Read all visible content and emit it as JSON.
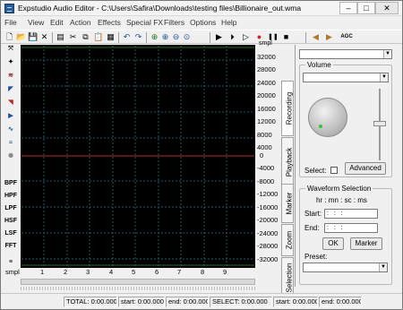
{
  "window": {
    "title": "Expstudio Audio Editor - C:\\Users\\Safira\\Downloads\\testing files\\Billionaire_out.wma",
    "min_glyph": "–",
    "max_glyph": "□",
    "close_glyph": "✕"
  },
  "menu": [
    "File",
    "View",
    "Edit",
    "Action",
    "Effects",
    "Special FX",
    "Filters",
    "Options",
    "Help"
  ],
  "toolbar_icons": [
    {
      "name": "new-file-icon",
      "glyph": "🗋"
    },
    {
      "name": "open-folder-icon",
      "glyph": "📂"
    },
    {
      "name": "save-icon",
      "glyph": "💾"
    },
    {
      "name": "close-icon",
      "glyph": "✕"
    },
    {
      "name": "properties-icon",
      "glyph": "▤"
    },
    {
      "name": "cut-icon",
      "glyph": "✂"
    },
    {
      "name": "copy-icon",
      "glyph": "⧉"
    },
    {
      "name": "paste-icon",
      "glyph": "📋"
    },
    {
      "name": "paste-mix-icon",
      "glyph": "▦"
    },
    {
      "name": "undo-icon",
      "glyph": "↶"
    },
    {
      "name": "redo-icon",
      "glyph": "↷"
    },
    {
      "name": "zoom-in-icon",
      "glyph": "⊕"
    },
    {
      "name": "zoom-in-vertical-icon",
      "glyph": "⊕"
    },
    {
      "name": "zoom-out-icon",
      "glyph": "⊖"
    },
    {
      "name": "zoom-fit-icon",
      "glyph": "⊙"
    },
    {
      "name": "play-icon",
      "glyph": "▶"
    },
    {
      "name": "play-loop-icon",
      "glyph": "⏵"
    },
    {
      "name": "play-from-icon",
      "glyph": "▷"
    },
    {
      "name": "record-icon",
      "glyph": "●"
    },
    {
      "name": "pause-icon",
      "glyph": "❚❚"
    },
    {
      "name": "stop-icon",
      "glyph": "■"
    },
    {
      "name": "volume-left-icon",
      "glyph": "◀"
    },
    {
      "name": "volume-right-icon",
      "glyph": "▶"
    },
    {
      "name": "agc-icon",
      "glyph": "AGC"
    }
  ],
  "left_tools": [
    {
      "name": "normalize-tool-icon",
      "label": "⤧"
    },
    {
      "name": "amplify-tool-icon",
      "label": "✦"
    },
    {
      "name": "echo-tool-icon",
      "label": "≋"
    },
    {
      "name": "fade-in-tool-icon",
      "label": "◤"
    },
    {
      "name": "fade-out-tool-icon",
      "label": "◥"
    },
    {
      "name": "reverse-tool-icon",
      "label": "▶"
    },
    {
      "name": "chorus-tool-icon",
      "label": "∿"
    },
    {
      "name": "flanger-tool-icon",
      "label": "≈"
    },
    {
      "name": "noise-tool-icon",
      "label": "✺"
    },
    {
      "name": "bpf-filter-icon",
      "label": "BPF"
    },
    {
      "name": "hpf-filter-icon",
      "label": "HPF"
    },
    {
      "name": "lpf-filter-icon",
      "label": "LPF"
    },
    {
      "name": "hsf-filter-icon",
      "label": "HSF"
    },
    {
      "name": "lsf-filter-icon",
      "label": "LSF"
    },
    {
      "name": "fft-filter-icon",
      "label": "FFT"
    },
    {
      "name": "multi-filter-icon",
      "label": "≡"
    }
  ],
  "y_ruler": {
    "unit": "smpl",
    "ticks": [
      "32000",
      "28000",
      "24000",
      "20000",
      "16000",
      "12000",
      "8000",
      "4000",
      "0",
      "-4000",
      "-8000",
      "-12000",
      "-16000",
      "-20000",
      "-24000",
      "-28000",
      "-32000"
    ]
  },
  "x_ruler": {
    "unit": "smpl",
    "ticks": [
      "1",
      "2",
      "3",
      "4",
      "5",
      "6",
      "7",
      "8",
      "9"
    ]
  },
  "tabs": {
    "recording": "Recording",
    "playback": "Playback",
    "marker": "Marker",
    "zoom": "Zoom",
    "selection": "Selection"
  },
  "recording_panel": {
    "device_combo": "",
    "volume_label": "Volume",
    "volume_combo": "",
    "select_label": "Select:",
    "select_checked": false,
    "advanced_button": "Advanced"
  },
  "waveform_selection": {
    "title": "Waveform Selection",
    "format": "hr : mn : sc : ms",
    "start_label": "Start:",
    "start_value": " :  :  :",
    "end_label": "End:",
    "end_value": " :  :  :",
    "ok_button": "OK",
    "marker_button": "Marker",
    "preset_label": "Preset:",
    "preset_value": ""
  },
  "status": {
    "total": "TOTAL: 0:00.000",
    "start1": "start: 0:00.000",
    "end1": "end: 0:00.000",
    "select": "SELECT: 0:00.000",
    "start2": "start: 0:00.000",
    "end2": "end: 0:00.000"
  },
  "colors": {
    "waveform_bg": "#000000",
    "grid": "#1f5a66",
    "center_line": "#b03030",
    "knob_indicator": "#2fc82f"
  }
}
